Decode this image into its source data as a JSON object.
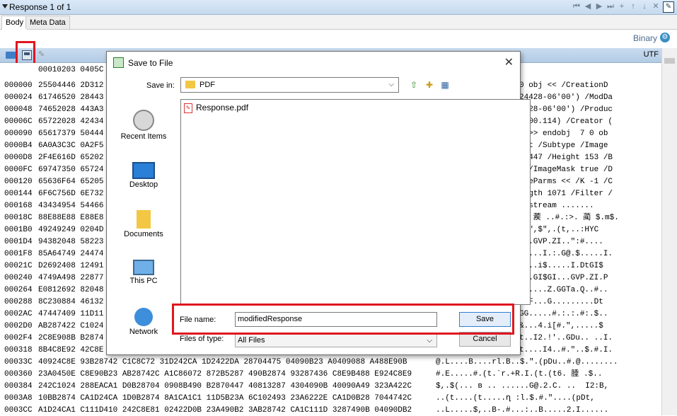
{
  "title": "Response 1 of 1",
  "nav_icons": [
    "⏮",
    "◀",
    "▶",
    "⏭",
    "+",
    "↑",
    "↓",
    "✕",
    "✎"
  ],
  "tabs": [
    "Body",
    "Meta Data"
  ],
  "encoding": {
    "binary_label": "Binary",
    "utf_label": "UTF"
  },
  "hex": {
    "header": "00010203 0405C",
    "rows": [
      {
        "offset": "000000",
        "bytes": "25504446 2D312",
        "ascii": "0 obj << /CreationD"
      },
      {
        "offset": "000024",
        "bytes": "61746520 28443",
        "ascii": "24428-06'00') /ModDa"
      },
      {
        "offset": "000048",
        "bytes": "74652028 443A3",
        "ascii": "4428-06'00') /Produc"
      },
      {
        "offset": "00006C",
        "bytes": "65722028 42434",
        "ascii": "3.00.114) /Creator ("
      },
      {
        "offset": "000090",
        "bytes": "65617379 50444",
        "ascii": ") >> endobj  7 0 ob"
      },
      {
        "offset": "0000B4",
        "bytes": "6A0A3C3C 0A2F5",
        "ascii": "ect /Subtype /Image"
      },
      {
        "offset": "0000D8",
        "bytes": "2F4E616D 65202",
        "ascii": "n 447 /Height 153 /B"
      },
      {
        "offset": "0000FC",
        "bytes": "69747350 65724",
        "ascii": "  /ImageMask true /D"
      },
      {
        "offset": "000120",
        "bytes": "65636F64 65205",
        "ascii": "odeParms << /K -1 /C"
      },
      {
        "offset": "000144",
        "bytes": "6F6C756D 6E732",
        "ascii": "ength 1071 /Filter /"
      },
      {
        "offset": "000168",
        "bytes": "43434954 54466",
        "ascii": "> stream ......."
      },
      {
        "offset": "00018C",
        "bytes": "88E88E88 E88E8",
        "ascii": ".. 蒺 ..#.:>. 蔺 $.m$."
      },
      {
        "offset": "0001B0",
        "bytes": "49249249 0204D",
        "ascii": ".$\",$\",.(t,..:HYC"
      },
      {
        "offset": "0001D4",
        "bytes": "94382048 58223",
        "ascii": "HZ.GVP.ZI..\":#...."
      },
      {
        "offset": "0001F8",
        "bytes": "85A64749 24474",
        "ascii": "ZI...I.:.G@.$.....I."
      },
      {
        "offset": "00021C",
        "bytes": "D2692408 12491",
        "ascii": "....i$.....I.DtGI$"
      },
      {
        "offset": "000240",
        "bytes": "4749A498 22877",
        "ascii": "$..GI$GI...GVP.ZI.P"
      },
      {
        "offset": "000264",
        "bytes": "E0812692 82048",
        "ascii": "YC....Z.GGTa.Q..#.."
      },
      {
        "offset": "000288",
        "bytes": "8C230884 46132",
        "ascii": "DDF...G.........Dt"
      },
      {
        "offset": "0002AC",
        "bytes": "47447409 11D11",
        "ascii": "GG.....#.:.:.#:.$.."
      },
      {
        "offset": "0002D0",
        "bytes": "AB287422 C1024",
        "ascii": "&...4.i[#.\",.....$"
      },
      {
        "offset": "0002F4",
        "bytes": "2C8E908B B2874",
        "ascii": "t..I2.!'..GDu.. ..I."
      },
      {
        "offset": "000318",
        "bytes": "8B4C8E92 42C8E",
        "ascii": "t....I4..#.\"..$.#.I."
      },
      {
        "offset": "00033C",
        "bytes": "40924C8E 93B28742 C1C8C72 31D242CA 1D2422DA 28704475 04090B23 A0409088 A488E90B",
        "ascii": "@.L....B....rl.B..$.\".(pDu..#.@........"
      },
      {
        "offset": "000360",
        "bytes": "23A0450E C8E90B23 AB28742C A1C86072 872B5287 490B2874 93287436 C8E9B488 E924C8E9",
        "ascii": "#.E.....#.(t.`r.+R.I.(t.(t6. 腄 .$.."
      },
      {
        "offset": "000384",
        "bytes": "242C1024 288EACA1 D0B28704 0908B490 B2870447 40813287 4304090B 40090A49 323A422C",
        "ascii": "$,.$(... в .. ......G@.2.C. ..  I2:B,"
      },
      {
        "offset": "0003A8",
        "bytes": "10BB2874 CA1D24CA 1D0B2874 8A1CA1C1 11D5B23A 6C102493 23A6222E CA1D0B28 7044742C",
        "ascii": "..(t....(t.....ղ :l.$.#.\"....(pDt,"
      },
      {
        "offset": "0003CC",
        "bytes": "A1D24CA1 C111D410 242C8E81 02422D0B 23A490B2 3AB28742 CA1C111D 3287490B 04090DB2",
        "ascii": "..L.....$,..B-.#...:..B.....2.I......"
      }
    ]
  },
  "dialog": {
    "title": "Save to File",
    "save_in_label": "Save in:",
    "save_in_value": "PDF",
    "places": [
      "Recent Items",
      "Desktop",
      "Documents",
      "This PC",
      "Network"
    ],
    "files": [
      "Response.pdf"
    ],
    "file_name_label": "File name:",
    "file_name_value": "modifiedResponse",
    "files_of_type_label": "Files of type:",
    "files_of_type_value": "All Files",
    "save_button": "Save",
    "cancel_button": "Cancel"
  }
}
